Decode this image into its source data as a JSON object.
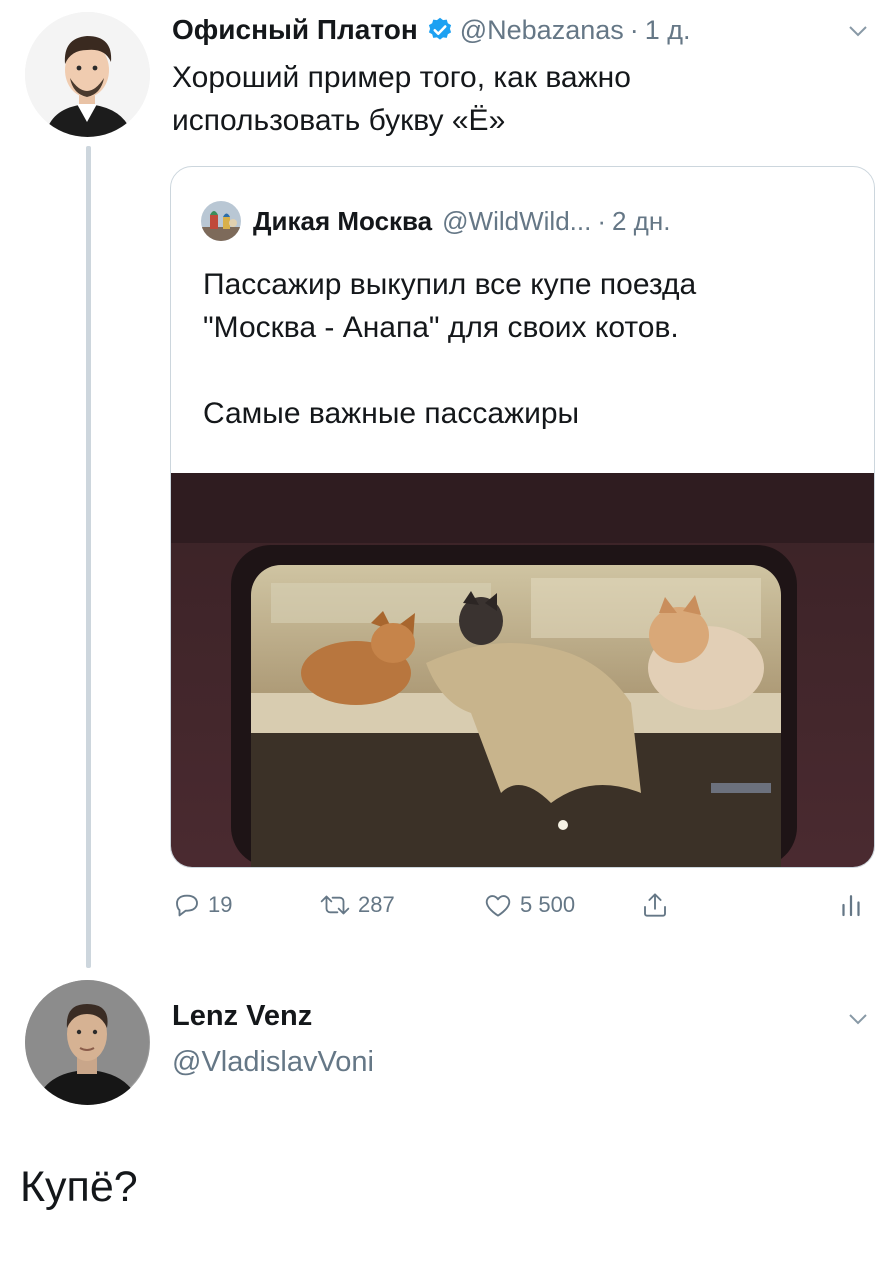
{
  "tweet": {
    "author_name": "Офисный Платон",
    "author_handle": "@Nebazanas",
    "separator": "·",
    "time": "1 д.",
    "text_lines": [
      "Хороший пример того, как важно",
      "использовать букву «Ё»"
    ],
    "verified": true
  },
  "quoted_tweet": {
    "author_name": "Дикая Москва",
    "author_handle": "@WildWild...",
    "separator": "·",
    "time": "2 дн.",
    "text_lines": [
      "Пассажир выкупил все купе поезда",
      "\"Москва - Анапа\" для своих котов.",
      "",
      "Самые важные пассажиры"
    ]
  },
  "actions": {
    "replies": "19",
    "retweets": "287",
    "likes": "5 500"
  },
  "reply": {
    "author_name": "Lenz Venz",
    "author_handle": "@VladislavVoni",
    "text": "Купё?"
  },
  "colors": {
    "text": "#14171a",
    "secondary": "#657786",
    "verified_blue": "#1da1f2",
    "thread_line": "#cdd6dd",
    "border": "#ccd6dd"
  },
  "icons": [
    "verified-badge-icon",
    "chevron-down-icon",
    "reply-icon",
    "retweet-icon",
    "like-icon",
    "share-icon",
    "analytics-icon"
  ]
}
